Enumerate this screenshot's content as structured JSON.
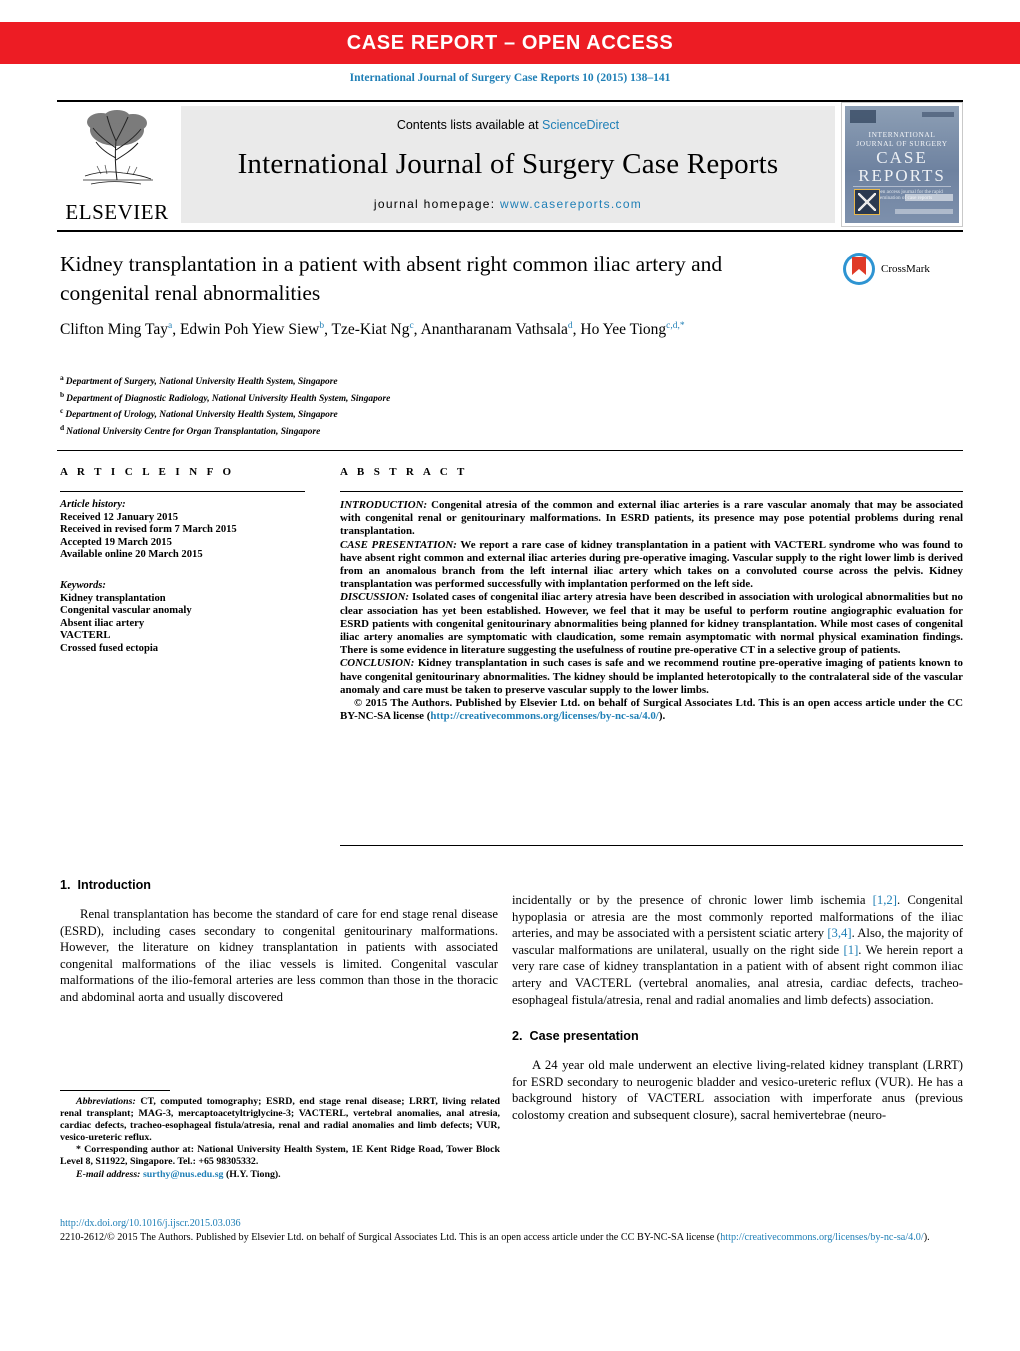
{
  "banner": {
    "text": "CASE REPORT – OPEN ACCESS"
  },
  "journal_ref": "International Journal of Surgery Case Reports 10 (2015) 138–141",
  "masthead": {
    "publisher_word": "ELSEVIER",
    "contents_prefix": "Contents lists available at ",
    "contents_link": "ScienceDirect",
    "journal_title": "International Journal of Surgery Case Reports",
    "homepage_prefix": "journal homepage: ",
    "homepage_url": "www.casereports.com",
    "cover": {
      "line1": "INTERNATIONAL",
      "line2": "JOURNAL OF SURGERY",
      "case": "CASE",
      "reports": "REPORTS",
      "tagline": "A free open access journal for the rapid dissemination of case reports"
    }
  },
  "article": {
    "title": "Kidney transplantation in a patient with absent right common iliac artery and congenital renal abnormalities",
    "crossmark_label": "CrossMark",
    "authors_html": "Clifton Ming Tay<sup>a</sup>, Edwin Poh Yiew Siew<sup>b</sup>, Tze-Kiat Ng<sup>c</sup>, Anantharanam Vathsala<sup>d</sup>, Ho Yee Tiong<sup>c,d,</sup><sup>*</sup>",
    "affiliations": [
      {
        "marker": "a",
        "text": "Department of Surgery, National University Health System, Singapore"
      },
      {
        "marker": "b",
        "text": "Department of Diagnostic Radiology, National University Health System, Singapore"
      },
      {
        "marker": "c",
        "text": "Department of Urology, National University Health System, Singapore"
      },
      {
        "marker": "d",
        "text": "National University Centre for Organ Transplantation, Singapore"
      }
    ]
  },
  "article_info": {
    "heading": "A R T I C L E   I N F O",
    "history_label": "Article history:",
    "history": [
      "Received 12 January 2015",
      "Received in revised form 7 March 2015",
      "Accepted 19 March 2015",
      "Available online 20 March 2015"
    ],
    "keywords_label": "Keywords:",
    "keywords": [
      "Kidney transplantation",
      "Congenital vascular anomaly",
      "Absent iliac artery",
      "VACTERL",
      "Crossed fused ectopia"
    ]
  },
  "abstract": {
    "heading": "A B S T R A C T",
    "sections": [
      {
        "label": "INTRODUCTION:",
        "text": " Congenital atresia of the common and external iliac arteries is a rare vascular anomaly that may be associated with congenital renal or genitourinary malformations. In ESRD patients, its presence may pose potential problems during renal transplantation."
      },
      {
        "label": "CASE PRESENTATION:",
        "text": " We report a rare case of kidney transplantation in a patient with VACTERL syndrome who was found to have absent right common and external iliac arteries during pre-operative imaging. Vascular supply to the right lower limb is derived from an anomalous branch from the left internal iliac artery which takes on a convoluted course across the pelvis. Kidney transplantation was performed successfully with implantation performed on the left side."
      },
      {
        "label": "DISCUSSION:",
        "text": " Isolated cases of congenital iliac artery atresia have been described in association with urological abnormalities but no clear association has yet been established. However, we feel that it may be useful to perform routine angiographic evaluation for ESRD patients with congenital genitourinary abnormalities being planned for kidney transplantation. While most cases of congenital iliac artery anomalies are symptomatic with claudication, some remain asymptomatic with normal physical examination findings. There is some evidence in literature suggesting the usefulness of routine pre-operative CT in a selective group of patients."
      },
      {
        "label": "CONCLUSION:",
        "text": " Kidney transplantation in such cases is safe and we recommend routine pre-operative imaging of patients known to have congenital genitourinary abnormalities. The kidney should be implanted heterotopically to the contralateral side of the vascular anomaly and care must be taken to preserve vascular supply to the lower limbs."
      }
    ],
    "copyright_pre": "© 2015 The Authors. Published by Elsevier Ltd. on behalf of Surgical Associates Ltd. This is an open access article under the CC BY-NC-SA license (",
    "copyright_link": "http://creativecommons.org/licenses/by-nc-sa/4.0/",
    "copyright_post": ")."
  },
  "sections": {
    "introduction": {
      "number": "1.",
      "title": "Introduction",
      "left_text": "Renal transplantation has become the standard of care for end stage renal disease (ESRD), including cases secondary to congenital genitourinary malformations. However, the literature on kidney transplantation in patients with associated congenital malformations of the iliac vessels is limited. Congenital vascular malformations of the ilio-femoral arteries are less common than those in the thoracic and abdominal aorta and usually discovered",
      "right_text_1": "incidentally or by the presence of chronic lower limb ischemia ",
      "ref_1": "[1,2]",
      "right_text_2": ". Congenital hypoplasia or atresia are the most commonly reported malformations of the iliac arteries, and may be associated with a persistent sciatic artery ",
      "ref_2": "[3,4]",
      "right_text_3": ". Also, the majority of vascular malformations are unilateral, usually on the right side ",
      "ref_3": "[1]",
      "right_text_4": ". We herein report a very rare case of kidney transplantation in a patient with of absent right common iliac artery and VACTERL (vertebral anomalies, anal atresia, cardiac defects, tracheo-esophageal fistula/atresia, renal and radial anomalies and limb defects) association."
    },
    "case_presentation": {
      "number": "2.",
      "title": "Case presentation",
      "text": "A 24 year old male underwent an elective living-related kidney transplant (LRRT) for ESRD secondary to neurogenic bladder and vesico-ureteric reflux (VUR). He has a background history of VACTERL association with imperforate anus (previous colostomy creation and subsequent closure), sacral hemivertebrae (neuro-"
    }
  },
  "footnotes": {
    "abbrev_label": "Abbreviations:",
    "abbrev_text": " CT, computed tomography; ESRD, end stage renal disease; LRRT, living related renal transplant; MAG-3, mercaptoacetyltriglycine-3; VACTERL, vertebral anomalies, anal atresia, cardiac defects, tracheo-esophageal fistula/atresia, renal and radial anomalies and limb defects; VUR, vesico-ureteric reflux.",
    "corresponding": "* Corresponding author at: National University Health System, 1E Kent Ridge Road, Tower Block Level 8, S11922, Singapore. Tel.: +65 98305332.",
    "email_label": "E-mail address:",
    "email": "surthy@nus.edu.sg",
    "email_suffix": " (H.Y. Tiong)."
  },
  "bottom": {
    "doi": "http://dx.doi.org/10.1016/j.ijscr.2015.03.036",
    "issn_copyright_pre": "2210-2612/© 2015 The Authors. Published by Elsevier Ltd. on behalf of Surgical Associates Ltd. This is an open access article under the CC BY-NC-SA license (",
    "license_link": "http://creativecommons.org/licenses/by-nc-sa/4.0/",
    "issn_copyright_post": ")."
  },
  "colors": {
    "banner_red": "#ed1c24",
    "link_blue": "#1f7fb6",
    "elsevier_orange": "#ef7c1a",
    "masthead_grey": "#eaeaea"
  }
}
